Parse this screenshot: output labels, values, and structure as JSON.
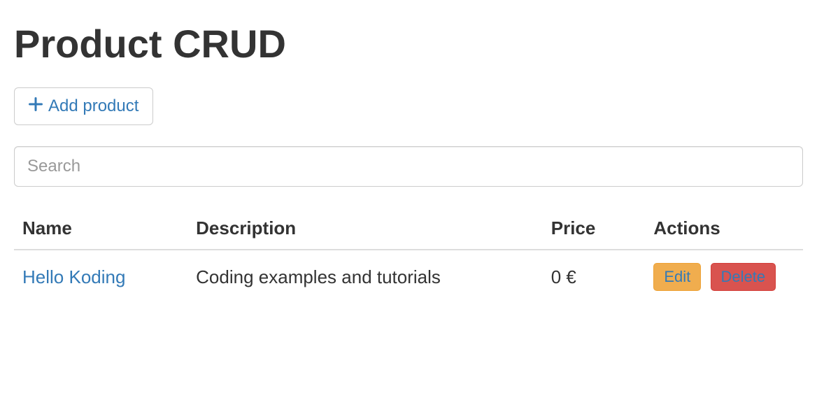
{
  "page": {
    "title": "Product CRUD"
  },
  "toolbar": {
    "add_label": "Add product"
  },
  "search": {
    "placeholder": "Search",
    "value": ""
  },
  "table": {
    "headers": {
      "name": "Name",
      "description": "Description",
      "price": "Price",
      "actions": "Actions"
    },
    "rows": [
      {
        "name": "Hello Koding",
        "description": "Coding examples and tutorials",
        "price": "0 €",
        "edit_label": "Edit",
        "delete_label": "Delete"
      }
    ]
  }
}
